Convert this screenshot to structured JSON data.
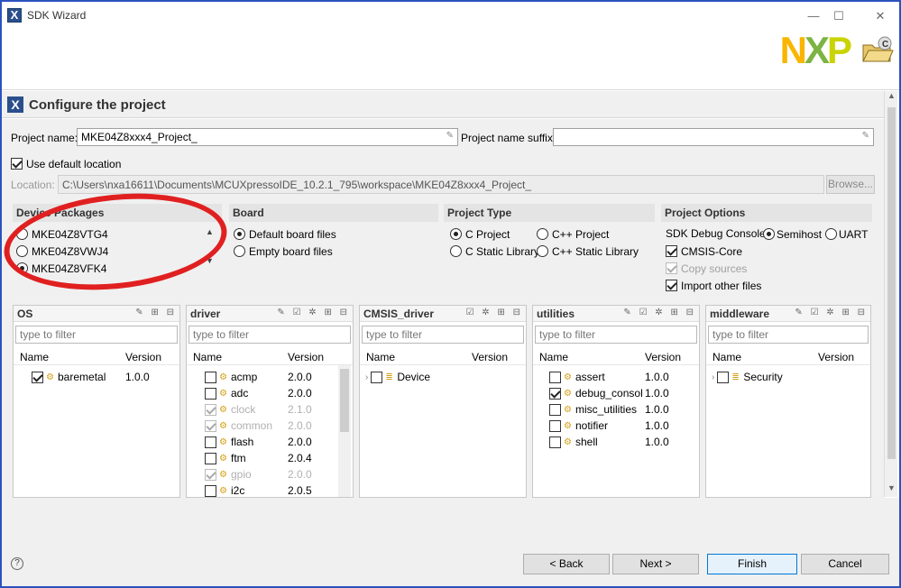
{
  "window": {
    "title": "SDK Wizard",
    "app_icon": "X",
    "minimize": "—",
    "maximize": "☐",
    "close": "✕"
  },
  "banner": {
    "logo_n": "N",
    "logo_x": "X",
    "logo_p": "P",
    "badge": "C"
  },
  "page": {
    "icon": "X",
    "title": "Configure the project"
  },
  "fields": {
    "project_name_label": "Project name:",
    "project_name_value": "MKE04Z8xxx4_Project_",
    "suffix_label": "Project name suffix:",
    "suffix_value": "",
    "use_default_location": "Use default location",
    "location_label": "Location:",
    "location_value": "C:\\Users\\nxa16611\\Documents\\MCUXpressoIDE_10.2.1_795\\workspace\\MKE04Z8xxx4_Project_",
    "browse": "Browse..."
  },
  "device_packages": {
    "title": "Device Packages",
    "items": [
      "MKE04Z8VTG4",
      "MKE04Z8VWJ4",
      "MKE04Z8VFK4"
    ],
    "selected": 2
  },
  "board": {
    "title": "Board",
    "options": [
      "Default board files",
      "Empty board files"
    ],
    "selected": 0
  },
  "project_type": {
    "title": "Project Type",
    "options": [
      "C Project",
      "C++ Project",
      "C Static Library",
      "C++ Static Library"
    ],
    "selected": 0
  },
  "project_options": {
    "title": "Project Options",
    "debug_console_label": "SDK Debug Console",
    "semihost": "Semihost",
    "uart": "UART",
    "cmsis_core": "CMSIS-Core",
    "copy_sources": "Copy sources",
    "import_other": "Import other files"
  },
  "panels": {
    "filter_placeholder": "type to filter",
    "col_name": "Name",
    "col_version": "Version",
    "os": {
      "title": "OS",
      "items": [
        {
          "name": "baremetal",
          "version": "1.0.0",
          "checked": true
        }
      ]
    },
    "driver": {
      "title": "driver",
      "items": [
        {
          "name": "acmp",
          "version": "2.0.0",
          "checked": false,
          "dim": false
        },
        {
          "name": "adc",
          "version": "2.0.0",
          "checked": false,
          "dim": false
        },
        {
          "name": "clock",
          "version": "2.1.0",
          "checked": true,
          "dim": true
        },
        {
          "name": "common",
          "version": "2.0.0",
          "checked": true,
          "dim": true
        },
        {
          "name": "flash",
          "version": "2.0.0",
          "checked": false,
          "dim": false
        },
        {
          "name": "ftm",
          "version": "2.0.4",
          "checked": false,
          "dim": false
        },
        {
          "name": "gpio",
          "version": "2.0.0",
          "checked": true,
          "dim": true
        },
        {
          "name": "i2c",
          "version": "2.0.5",
          "checked": false,
          "dim": false
        }
      ]
    },
    "cmsis_driver": {
      "title": "CMSIS_driver",
      "items": [
        {
          "name": "Device",
          "version": ""
        }
      ]
    },
    "utilities": {
      "title": "utilities",
      "items": [
        {
          "name": "assert",
          "version": "1.0.0",
          "checked": false
        },
        {
          "name": "debug_consol",
          "version": "1.0.0",
          "checked": true
        },
        {
          "name": "misc_utilities",
          "version": "1.0.0",
          "checked": false
        },
        {
          "name": "notifier",
          "version": "1.0.0",
          "checked": false
        },
        {
          "name": "shell",
          "version": "1.0.0",
          "checked": false
        }
      ]
    },
    "middleware": {
      "title": "middleware",
      "items": [
        {
          "name": "Security",
          "version": ""
        }
      ]
    }
  },
  "footer": {
    "help": "?",
    "back": "< Back",
    "next": "Next >",
    "finish": "Finish",
    "cancel": "Cancel"
  },
  "colors": {
    "accent": "#0078d7",
    "annotation": "#e02020",
    "nxp_yellow": "#f9b500",
    "nxp_green": "#7cb342"
  }
}
